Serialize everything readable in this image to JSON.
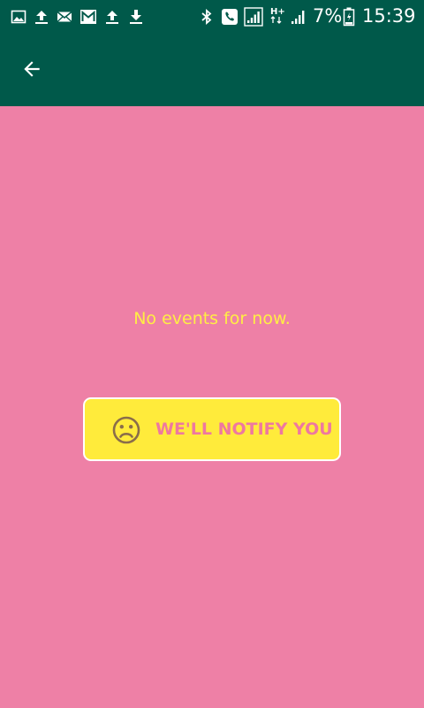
{
  "status_bar": {
    "left_icons": [
      "image-icon",
      "upload-icon",
      "mail-icon",
      "gmail-icon",
      "upload-icon",
      "download-icon"
    ],
    "right_icons": [
      "bluetooth-icon",
      "call-icon",
      "signal-icon",
      "hplus-data-icon",
      "signal-bars-icon",
      "battery-icon"
    ],
    "battery": "7%",
    "time": "15:39",
    "background": "#00594a"
  },
  "app_bar": {
    "back_icon": "arrow-back-icon",
    "background": "#00594a"
  },
  "content": {
    "background": "#ee80a6",
    "empty_message": "No events for now.",
    "empty_message_color": "#ffee44"
  },
  "notify_button": {
    "icon": "sad-face-icon",
    "label": "WE'LL NOTIFY YOU",
    "background": "#ffeb3b",
    "label_color": "#ee78a0"
  }
}
